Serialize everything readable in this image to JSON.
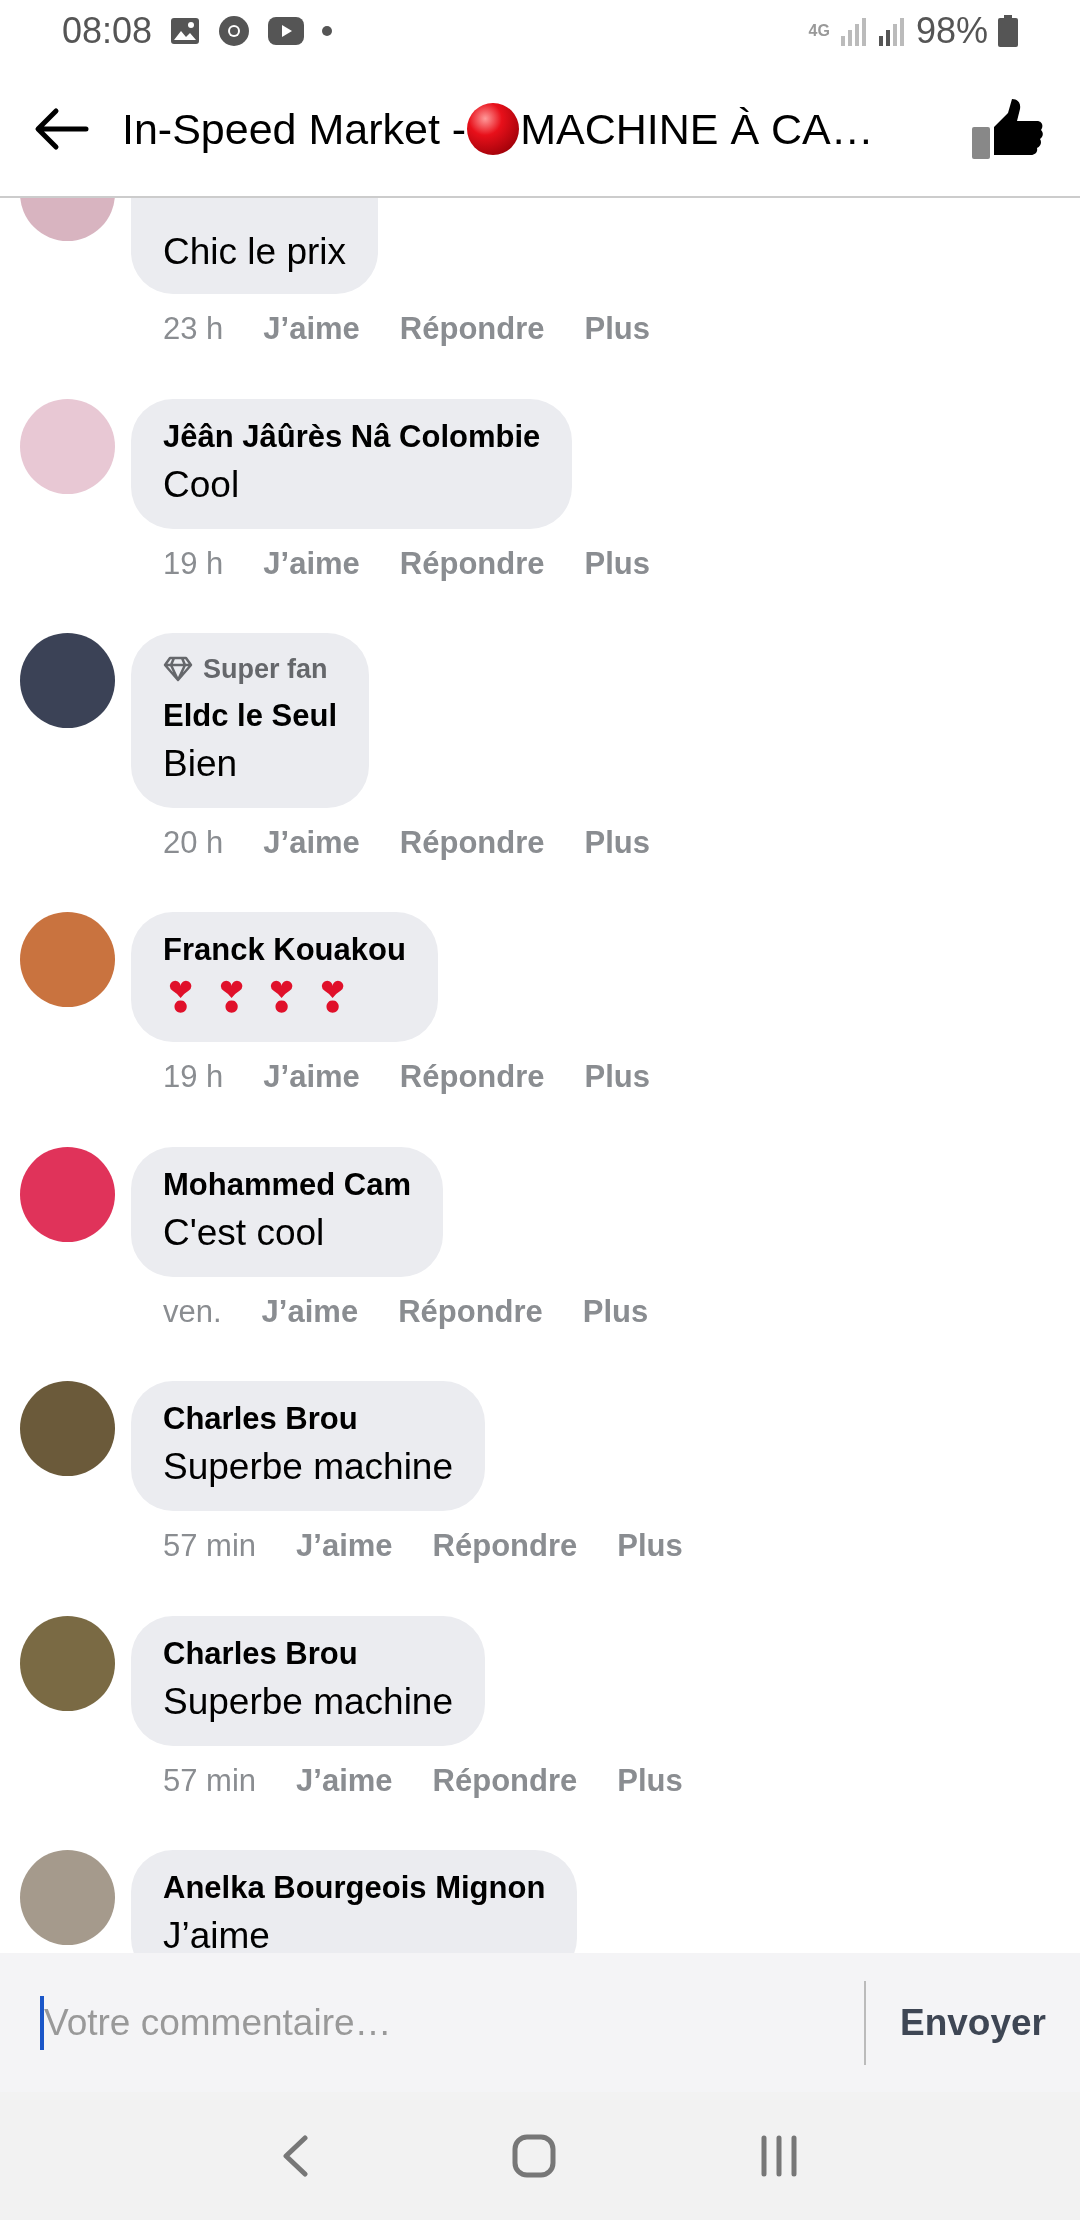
{
  "status_bar": {
    "time": "08:08",
    "network": "4G",
    "battery": "98%"
  },
  "header": {
    "title_parts": [
      "In-Speed Market - ",
      "MACHINE À CA…"
    ]
  },
  "comments": [
    {
      "text": "Chic le prix",
      "time": "23 h",
      "color": "#d8b4c0",
      "actions": [
        "J’aime",
        "Répondre",
        "Plus"
      ]
    },
    {
      "name": "Jêân Jâûrès Nâ Colombie",
      "text": "Cool",
      "time": "19 h",
      "color": "#e8c8d4",
      "actions": [
        "J’aime",
        "Répondre",
        "Plus"
      ]
    },
    {
      "badge": "Super fan",
      "name": "Eldc le Seul",
      "text": "Bien",
      "time": "20 h",
      "color": "#3b4256",
      "actions": [
        "J’aime",
        "Répondre",
        "Plus"
      ]
    },
    {
      "name": "Franck Kouakou",
      "text": "❣ ❣ ❣ ❣",
      "kind": "hearts",
      "time": "19 h",
      "color": "#c9733f",
      "actions": [
        "J’aime",
        "Répondre",
        "Plus"
      ]
    },
    {
      "name": "Mohammed Cam",
      "text": "C'est cool",
      "time": "ven.",
      "color": "#e0335a",
      "actions": [
        "J’aime",
        "Répondre",
        "Plus"
      ]
    },
    {
      "name": "Charles Brou",
      "text": "Superbe machine",
      "time": "57 min",
      "color": "#6b5a3a",
      "actions": [
        "J’aime",
        "Répondre",
        "Plus"
      ]
    },
    {
      "name": "Charles Brou",
      "text": "Superbe machine",
      "time": "57 min",
      "color": "#7a6a44",
      "actions": [
        "J’aime",
        "Répondre",
        "Plus"
      ]
    },
    {
      "name": "Anelka Bourgeois Mignon",
      "text": "J’aime",
      "color": "#a59a8c"
    }
  ],
  "composer": {
    "placeholder": "Votre commentaire…",
    "send": "Envoyer"
  }
}
